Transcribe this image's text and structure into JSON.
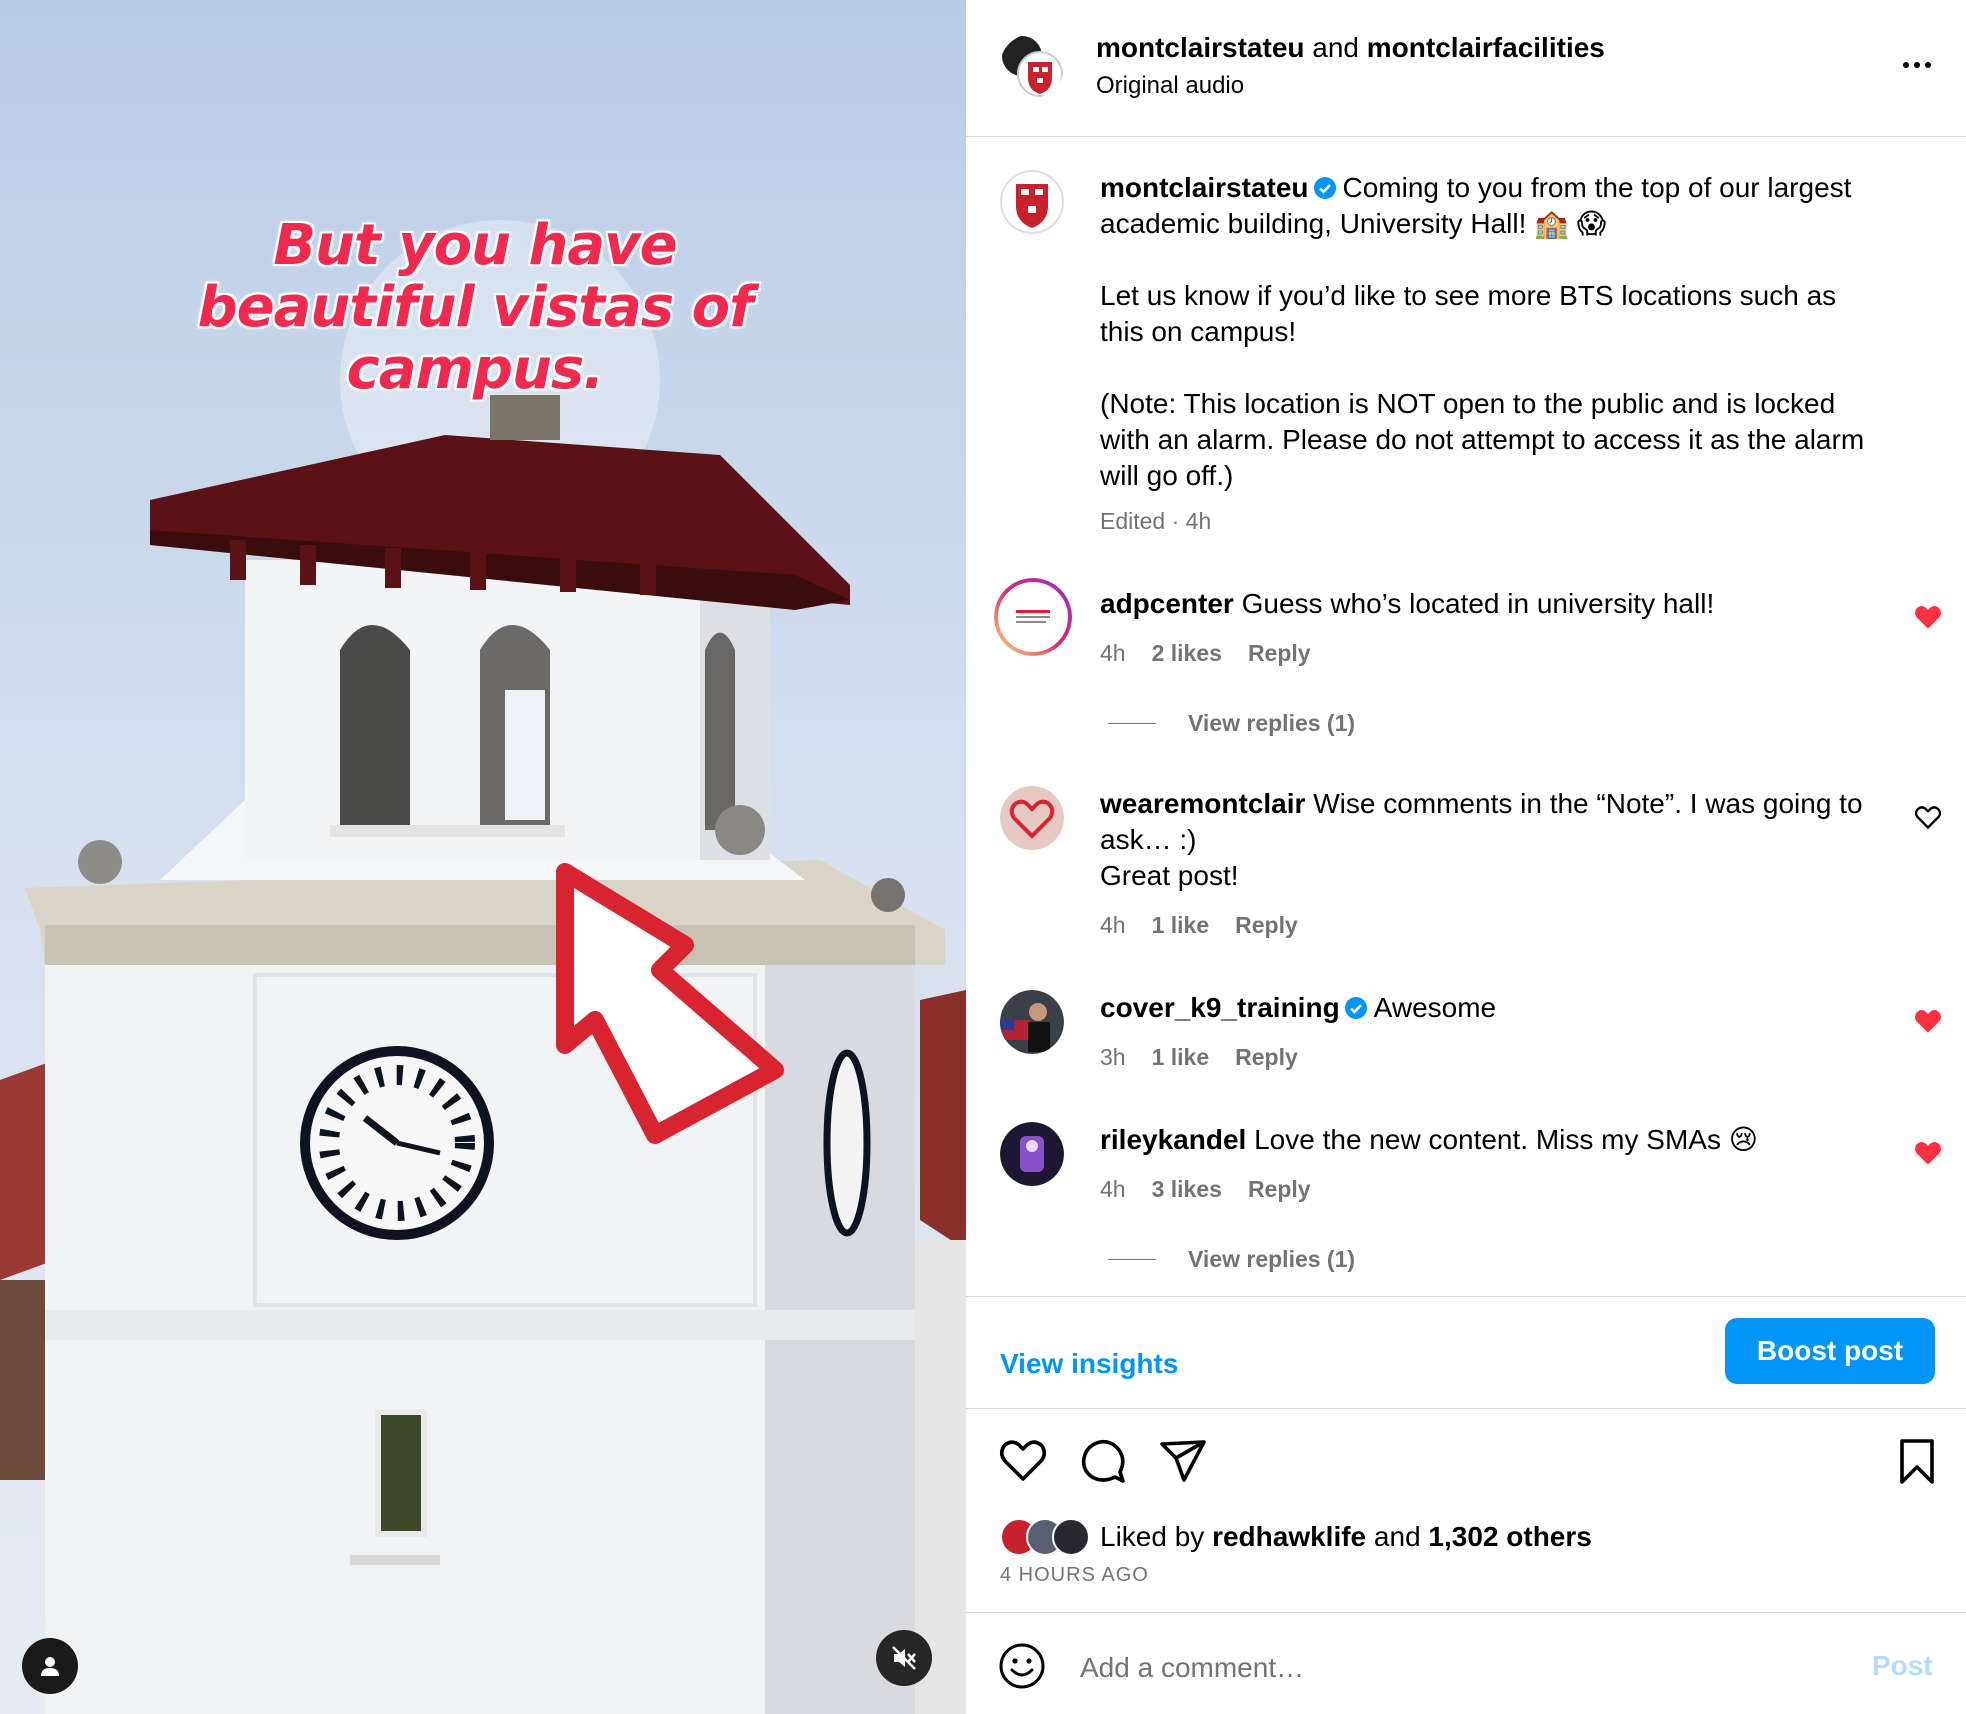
{
  "media": {
    "overlay_text": "But you have beautiful vistas of campus."
  },
  "header": {
    "account1": "montclairstateu",
    "conjunction": "and",
    "account2": "montclairfacilities",
    "audio": "Original audio"
  },
  "caption": {
    "user": "montclairstateu",
    "line1": "Coming to you from the top of our largest academic building, University Hall! 🏫 😱",
    "line2": "Let us know if you’d like to see more BTS locations such as this on campus!",
    "line3": "(Note: This location is NOT open to the public and is locked with an alarm. Please do not attempt to access it as the alarm will go off.)",
    "meta": "Edited · 4h"
  },
  "comments": [
    {
      "user": "adpcenter",
      "text": "Guess who’s located in university hall!",
      "time": "4h",
      "likes": "2 likes",
      "reply": "Reply",
      "view_replies": "View replies (1)",
      "liked": true
    },
    {
      "user": "wearemontclair",
      "text": "Wise comments in the “Note”. I was going to ask… :)",
      "text2": "Great post!",
      "time": "4h",
      "likes": "1 like",
      "reply": "Reply",
      "liked": false
    },
    {
      "user": "cover_k9_training",
      "text": "Awesome",
      "time": "3h",
      "likes": "1 like",
      "reply": "Reply",
      "liked": true
    },
    {
      "user": "rileykandel",
      "text": "Love the new content. Miss my SMAs 😢",
      "time": "4h",
      "likes": "3 likes",
      "reply": "Reply",
      "view_replies": "View replies (1)",
      "liked": true
    }
  ],
  "actions": {
    "view_insights": "View insights",
    "boost_post": "Boost post"
  },
  "likes": {
    "prefix": "Liked by",
    "user": "redhawklife",
    "middle": "and",
    "others": "1,302 others"
  },
  "time_ago": "4 HOURS AGO",
  "comment_box": {
    "placeholder": "Add a comment…",
    "post_label": "Post"
  },
  "colors": {
    "accent": "#0095f6",
    "like_red": "#ff3040",
    "overlay_red": "#f02a4e"
  }
}
